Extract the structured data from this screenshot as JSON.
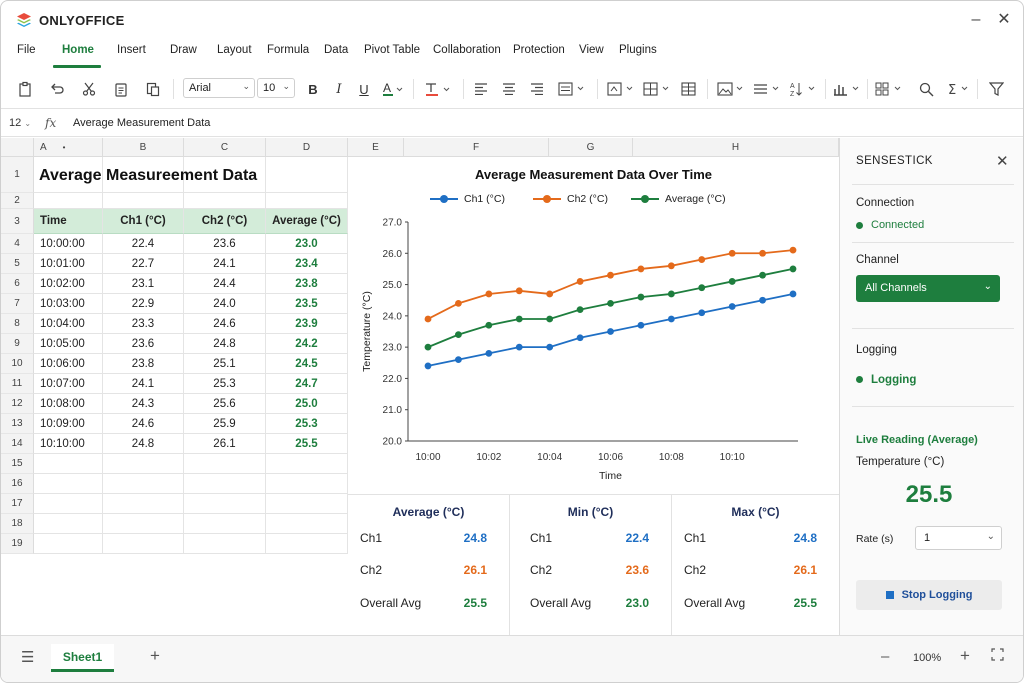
{
  "app": {
    "title": "ONLYOFFICE"
  },
  "menu": {
    "tabs": [
      "File",
      "Home",
      "Insert",
      "Draw",
      "Layout",
      "Formula",
      "Data",
      "Pivot Table",
      "Collaboration",
      "Protection",
      "View",
      "Plugins"
    ],
    "active": "Home"
  },
  "toolbar": {
    "font_name": "Arial",
    "font_size": "10"
  },
  "formula_bar": {
    "cell_ref": "12",
    "fx": "fx",
    "content": "Average Measurement Data"
  },
  "sheet": {
    "columns": [
      "A",
      "B",
      "C",
      "D",
      "E",
      "F",
      "G",
      "H"
    ],
    "rows": [
      "1",
      "2",
      "3",
      "4",
      "5",
      "6",
      "7",
      "8",
      "9",
      "10",
      "11",
      "12",
      "13",
      "14",
      "15",
      "16",
      "17",
      "18",
      "19"
    ],
    "title": "Average Measureement Data",
    "table_headers": [
      "Time",
      "Ch1 (°C)",
      "Ch2 (°C)",
      "Average (°C)"
    ],
    "table_rows": [
      [
        "10:00:00",
        "22.4",
        "23.6",
        "23.0"
      ],
      [
        "10:01:00",
        "22.7",
        "24.1",
        "23.4"
      ],
      [
        "10:02:00",
        "23.1",
        "24.4",
        "23.8"
      ],
      [
        "10:03:00",
        "22.9",
        "24.0",
        "23.5"
      ],
      [
        "10:04:00",
        "23.3",
        "24.6",
        "23.9"
      ],
      [
        "10:05:00",
        "23.6",
        "24.8",
        "24.2"
      ],
      [
        "10:06:00",
        "23.8",
        "25.1",
        "24.5"
      ],
      [
        "10:07:00",
        "24.1",
        "25.3",
        "24.7"
      ],
      [
        "10:08:00",
        "24.3",
        "25.6",
        "25.0"
      ],
      [
        "10:09:00",
        "24.6",
        "25.9",
        "25.3"
      ],
      [
        "10:10:00",
        "24.8",
        "26.1",
        "25.5"
      ]
    ]
  },
  "chart_data": {
    "type": "line",
    "title": "Average Measurement Data Over Time",
    "xlabel": "Time",
    "ylabel": "Temperature (°C)",
    "x_tick_labels": [
      "10:00",
      "10:02",
      "10:04",
      "10:06",
      "10:08",
      "10:10"
    ],
    "y_tick_labels": [
      "20.0",
      "21.0",
      "22.0",
      "23.0",
      "24.0",
      "25.0",
      "26.0",
      "27.0"
    ],
    "ylim": [
      20,
      27
    ],
    "grid": false,
    "legend_position": "top",
    "series": [
      {
        "name": "Ch1 (°C)",
        "color": "#1f6fc4",
        "values": [
          22.4,
          22.6,
          22.8,
          23.0,
          23.0,
          23.3,
          23.5,
          23.7,
          23.9,
          24.1,
          24.3,
          24.5,
          24.7
        ]
      },
      {
        "name": "Ch2 (°C)",
        "color": "#e46a1b",
        "values": [
          23.9,
          24.4,
          24.7,
          24.8,
          24.7,
          25.1,
          25.3,
          25.5,
          25.6,
          25.8,
          26.0,
          26.0,
          26.1
        ]
      },
      {
        "name": "Average (°C)",
        "color": "#1e7e3e",
        "values": [
          23.0,
          23.4,
          23.7,
          23.9,
          23.9,
          24.2,
          24.4,
          24.6,
          24.7,
          24.9,
          25.1,
          25.3,
          25.5
        ]
      }
    ]
  },
  "stats": {
    "columns": [
      {
        "heading": "Average (°C)",
        "rows": [
          [
            "Ch1",
            "24.8"
          ],
          [
            "Ch2",
            "26.1"
          ],
          [
            "Overall Avg",
            "25.5"
          ]
        ]
      },
      {
        "heading": "Min (°C)",
        "rows": [
          [
            "Ch1",
            "22.4"
          ],
          [
            "Ch2",
            "23.6"
          ],
          [
            "Overall Avg",
            "23.0"
          ]
        ]
      },
      {
        "heading": "Max (°C)",
        "rows": [
          [
            "Ch1",
            "24.8"
          ],
          [
            "Ch2",
            "26.1"
          ],
          [
            "Overall Avg",
            "25.5"
          ]
        ]
      }
    ],
    "colors": {
      "Ch1": "#1f6fc4",
      "Ch2": "#e46a1b",
      "Overall Avg": "#1e7e3e"
    }
  },
  "panel": {
    "title": "SENSESTICK",
    "connection_label": "Connection",
    "connection_status": "Connected",
    "channel_label": "Channel",
    "channel_value": "All Channels",
    "logging_label": "Logging",
    "logging_status": "Logging",
    "live_reading_label": "Live Reading (Average)",
    "temperature_label": "Temperature (°C)",
    "temperature_value": "25.5",
    "rate_label": "Rate (s)",
    "rate_value": "1",
    "stop_button": "Stop Logging"
  },
  "bottom": {
    "sheet_tab": "Sheet1",
    "zoom": "100%"
  }
}
